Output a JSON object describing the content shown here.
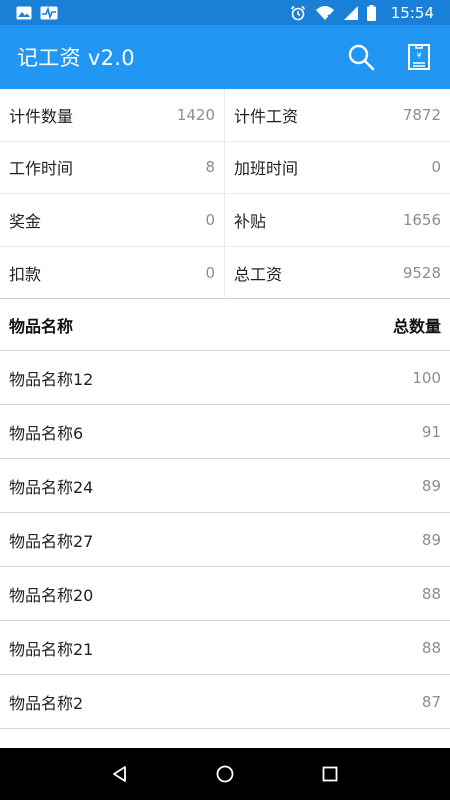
{
  "status_bar": {
    "time": "15:54",
    "icons": [
      "image-icon",
      "activity-icon",
      "alarm-icon",
      "wifi-icon",
      "signal-icon",
      "battery-icon"
    ]
  },
  "app_bar": {
    "title": "记工资 v2.0",
    "actions": [
      "search-icon",
      "receipt-icon"
    ],
    "receipt_glyph": "¥"
  },
  "summary": {
    "rows": [
      [
        {
          "label": "计件数量",
          "value": "1420"
        },
        {
          "label": "计件工资",
          "value": "7872"
        }
      ],
      [
        {
          "label": "工作时间",
          "value": "8"
        },
        {
          "label": "加班时间",
          "value": "0"
        }
      ],
      [
        {
          "label": "奖金",
          "value": "0"
        },
        {
          "label": "补贴",
          "value": "1656"
        }
      ],
      [
        {
          "label": "扣款",
          "value": "0"
        },
        {
          "label": "总工资",
          "value": "9528"
        }
      ]
    ]
  },
  "list": {
    "header_name": "物品名称",
    "header_qty": "总数量",
    "items": [
      {
        "name": "物品名称12",
        "qty": "100"
      },
      {
        "name": "物品名称6",
        "qty": "91"
      },
      {
        "name": "物品名称24",
        "qty": "89"
      },
      {
        "name": "物品名称27",
        "qty": "89"
      },
      {
        "name": "物品名称20",
        "qty": "88"
      },
      {
        "name": "物品名称21",
        "qty": "88"
      },
      {
        "name": "物品名称2",
        "qty": "87"
      }
    ]
  },
  "colors": {
    "status_bar": "#1a7fd6",
    "app_bar": "#2196f3",
    "value_text": "#8d8d8d"
  }
}
